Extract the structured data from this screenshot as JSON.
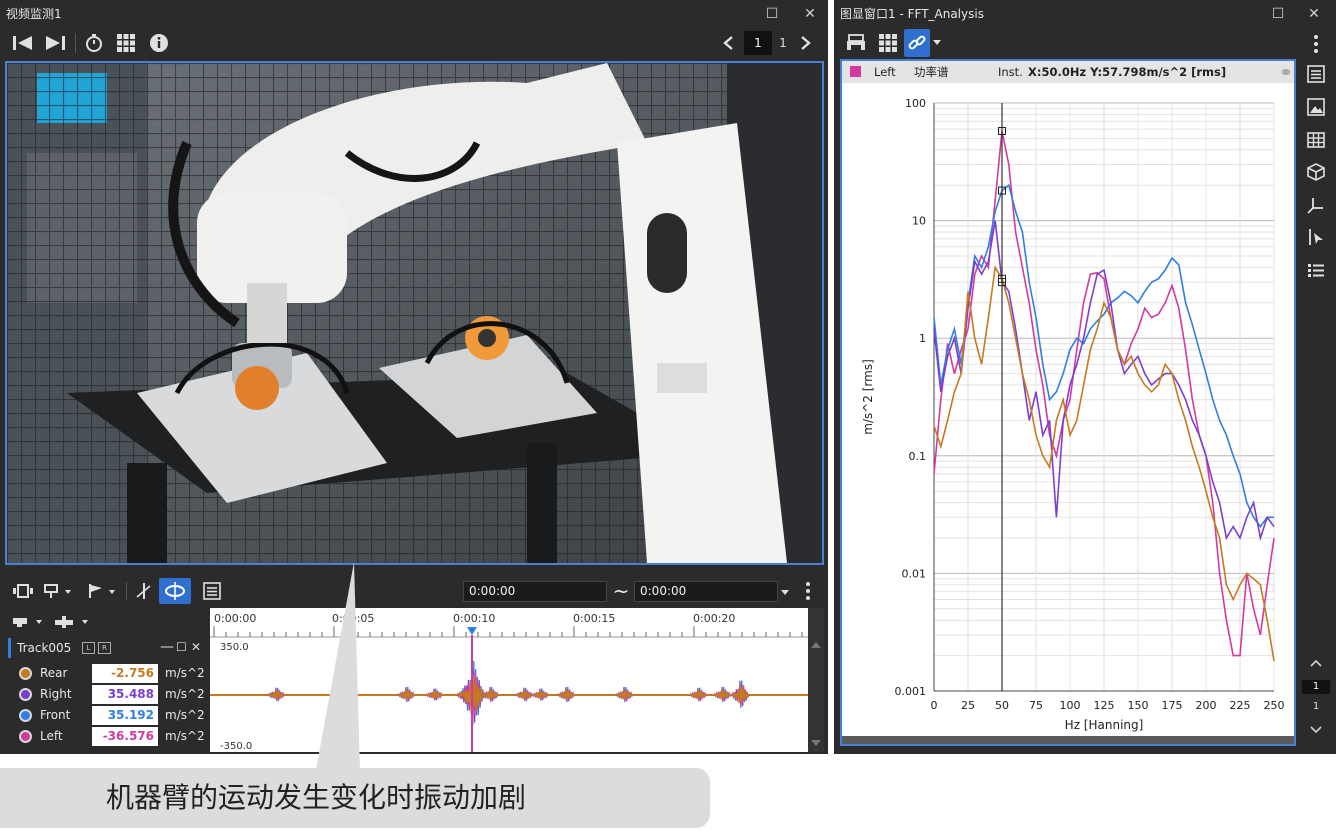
{
  "video_window": {
    "title": "视频监测1",
    "page_current": "1",
    "page_total": "1",
    "time_start": "0:00:00",
    "time_end": "0:00:00",
    "wave_time_labels": [
      "0:00:00",
      "0:00:05",
      "0:00:10",
      "0:00:15",
      "0:00:20"
    ],
    "wave_max": "350.0",
    "wave_min": "-350.0",
    "track": {
      "name": "Track005",
      "tag_l": "L",
      "tag_r": "R",
      "rows": [
        {
          "label": "Rear",
          "value": "-2.756",
          "unit": "m/s^2",
          "color": "#c67a1f"
        },
        {
          "label": "Right",
          "value": "35.488",
          "unit": "m/s^2",
          "color": "#7b3fd0"
        },
        {
          "label": "Front",
          "value": "35.192",
          "unit": "m/s^2",
          "color": "#2f7fe0"
        },
        {
          "label": "Left",
          "value": "-36.576",
          "unit": "m/s^2",
          "color": "#d33aa0"
        }
      ]
    }
  },
  "graph_window": {
    "title": "图显窗口1 - FFT_Analysis",
    "legend_channel": "Left",
    "legend_type": "功率谱",
    "cursor_readout_prefix": "Inst.",
    "cursor_readout": "X:50.0Hz Y:57.798m/s^2 [rms]",
    "side_page": "1",
    "side_page_total": "1"
  },
  "chart_data": {
    "type": "line",
    "title": "",
    "xlabel": "Hz [Hanning]",
    "ylabel": "m/s^2 [rms]",
    "xlim": [
      0,
      250
    ],
    "ylim": [
      0.001,
      100
    ],
    "yscale": "log",
    "grid": true,
    "x_ticks": [
      "0",
      "25",
      "50",
      "75",
      "100",
      "125",
      "150",
      "175",
      "200",
      "225",
      "250"
    ],
    "y_ticks": [
      "100",
      "10",
      "1",
      "0.1",
      "0.01",
      "0.001"
    ],
    "cursor_x": 50,
    "x": [
      0,
      5,
      10,
      15,
      20,
      25,
      30,
      35,
      40,
      45,
      50,
      55,
      60,
      65,
      70,
      75,
      80,
      85,
      90,
      95,
      100,
      105,
      110,
      115,
      120,
      125,
      130,
      135,
      140,
      145,
      150,
      155,
      160,
      165,
      170,
      175,
      180,
      185,
      190,
      195,
      200,
      205,
      210,
      215,
      220,
      225,
      230,
      235,
      240,
      245,
      250
    ],
    "series": [
      {
        "name": "Left",
        "color": "#d33aa0",
        "values": [
          0.07,
          0.3,
          0.9,
          0.5,
          0.8,
          1.2,
          3.5,
          5.0,
          4.0,
          15,
          57.8,
          30,
          8,
          4,
          2,
          0.8,
          0.4,
          0.15,
          0.1,
          0.2,
          0.3,
          0.8,
          2.0,
          3.5,
          3.6,
          3.2,
          1.5,
          0.8,
          0.6,
          0.9,
          1.2,
          1.8,
          1.5,
          1.6,
          2.0,
          2.8,
          1.8,
          0.8,
          0.3,
          0.15,
          0.1,
          0.04,
          0.01,
          0.004,
          0.002,
          0.002,
          0.01,
          0.005,
          0.003,
          0.008,
          0.02
        ]
      },
      {
        "name": "Front",
        "color": "#2f7fe0",
        "values": [
          1.5,
          0.4,
          0.8,
          1.2,
          0.6,
          2.0,
          5.0,
          4.0,
          6.0,
          12,
          18,
          20,
          12,
          8,
          3,
          1.5,
          0.6,
          0.3,
          0.35,
          0.5,
          0.8,
          1.0,
          0.9,
          1.2,
          1.4,
          1.6,
          2.0,
          2.2,
          2.5,
          2.3,
          2.0,
          2.5,
          3.0,
          3.2,
          3.8,
          4.8,
          4.2,
          2.0,
          1.3,
          0.8,
          0.5,
          0.3,
          0.2,
          0.15,
          0.1,
          0.07,
          0.04,
          0.03,
          0.025,
          0.03,
          0.03
        ]
      },
      {
        "name": "Right",
        "color": "#7b3fd0",
        "values": [
          1.2,
          0.35,
          0.7,
          1.0,
          0.5,
          1.8,
          4.5,
          3.5,
          4.5,
          10,
          3.0,
          2.5,
          1.2,
          0.5,
          0.2,
          0.35,
          0.15,
          0.2,
          0.03,
          0.2,
          0.4,
          0.6,
          1.0,
          2.0,
          3.5,
          3.8,
          2.0,
          0.8,
          0.5,
          0.6,
          0.7,
          0.5,
          0.4,
          0.45,
          0.5,
          0.5,
          0.4,
          0.3,
          0.2,
          0.15,
          0.1,
          0.06,
          0.04,
          0.02,
          0.025,
          0.02,
          0.03,
          0.04,
          0.02,
          0.03,
          0.025
        ]
      },
      {
        "name": "Rear",
        "color": "#c67a1f",
        "values": [
          0.18,
          0.12,
          0.2,
          0.35,
          0.5,
          2.5,
          1.0,
          0.6,
          1.5,
          4.0,
          3.2,
          2.0,
          1.0,
          0.5,
          0.3,
          0.15,
          0.1,
          0.08,
          0.2,
          0.3,
          0.15,
          0.2,
          0.4,
          0.8,
          1.2,
          2.0,
          1.5,
          0.8,
          0.6,
          0.7,
          0.5,
          0.4,
          0.35,
          0.4,
          0.6,
          0.5,
          0.3,
          0.2,
          0.12,
          0.08,
          0.05,
          0.03,
          0.02,
          0.008,
          0.006,
          0.008,
          0.01,
          0.009,
          0.008,
          0.004,
          0.0018
        ]
      }
    ]
  },
  "caption": "机器臂的运动发生变化时振动加剧"
}
